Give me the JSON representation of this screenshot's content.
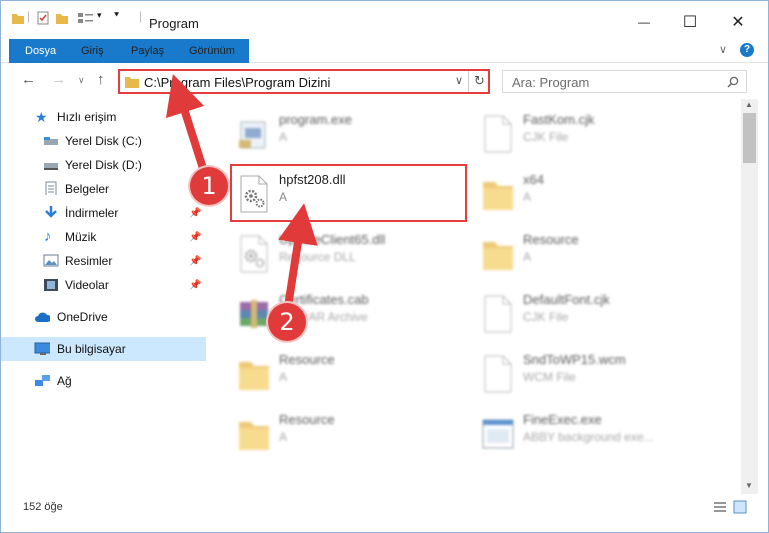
{
  "window": {
    "title": "Program",
    "minimize": "—",
    "maximize": "☐",
    "close": "✕"
  },
  "ribbon": {
    "tabs": [
      "Dosya",
      "Giriş",
      "Paylaş",
      "Görünüm"
    ],
    "help": "?",
    "expand": "∨"
  },
  "address": {
    "path": "C:\\Program Files\\Program Dizini",
    "search_placeholder": "Ara: Program"
  },
  "nav": {
    "items": [
      {
        "label": "Hızlı erişim",
        "icon": "star-icon"
      },
      {
        "label": "Yerel Disk (C:)",
        "icon": "drive-icon"
      },
      {
        "label": "Yerel Disk (D:)",
        "icon": "drive-icon"
      },
      {
        "label": "Belgeler",
        "icon": "documents-icon"
      },
      {
        "label": "İndirmeler",
        "icon": "download-icon"
      },
      {
        "label": "Müzik",
        "icon": "music-icon"
      },
      {
        "label": "Resimler",
        "icon": "pictures-icon"
      },
      {
        "label": "Videolar",
        "icon": "videos-icon"
      },
      {
        "label": "OneDrive",
        "icon": "cloud-icon"
      },
      {
        "label": "Bu bilgisayar",
        "icon": "computer-icon"
      },
      {
        "label": "Ağ",
        "icon": "network-icon"
      }
    ]
  },
  "files": [
    {
      "name": "program.exe",
      "type": "A",
      "icon": "exe-icon"
    },
    {
      "name": "FastKom.cjk",
      "type": "CJK File",
      "icon": "file-icon"
    },
    {
      "name": "hpfst208.dll",
      "type": "A",
      "icon": "dll-gear-icon"
    },
    {
      "name": "x64",
      "type": "A",
      "icon": "folder-icon"
    },
    {
      "name": "UpdateClient65.dll",
      "type": "Resource DLL",
      "icon": "dll-gear-icon"
    },
    {
      "name": "Resource",
      "type": "A",
      "icon": "folder-icon"
    },
    {
      "name": "Certificates.cab",
      "type": "WinRAR Archive",
      "icon": "archive-icon"
    },
    {
      "name": "DefaultFont.cjk",
      "type": "CJK File",
      "icon": "file-icon"
    },
    {
      "name": "Resource",
      "type": "A",
      "icon": "folder-icon"
    },
    {
      "name": "SndToWP15.wcm",
      "type": "WCM File",
      "icon": "file-icon"
    },
    {
      "name": "Resource",
      "type": "A",
      "icon": "folder-icon"
    },
    {
      "name": "FineExec.exe",
      "type": "ABBY background exe...",
      "icon": "app-window-icon"
    }
  ],
  "status": {
    "count": "152 öğe"
  },
  "annotations": {
    "badge1": "1",
    "badge2": "2"
  },
  "colors": {
    "accent": "#1979ca",
    "highlight": "#e53c3c",
    "selected": "#cce8ff"
  }
}
